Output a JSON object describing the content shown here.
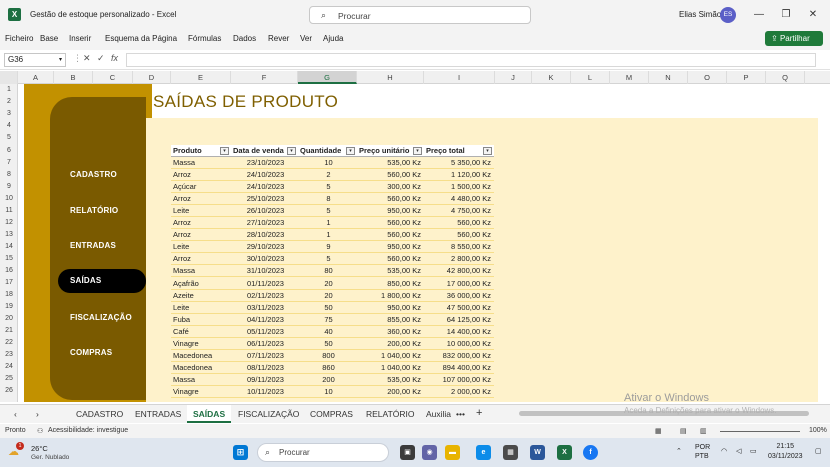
{
  "window": {
    "app_icon": "X",
    "title": "Gestão de estoque personalizado  -  Excel",
    "search_placeholder": "Procurar",
    "user_name": "Elias Simão",
    "user_initials": "ES",
    "btn_minimize": "—",
    "btn_restore": "❐",
    "btn_close": "✕"
  },
  "ribbon": {
    "tabs": [
      "Ficheiro",
      "Base",
      "Inserir",
      "Esquema da Página",
      "Fórmulas",
      "Dados",
      "Rever",
      "Ver",
      "Ajuda"
    ],
    "share_label": "Partilhar"
  },
  "formula_bar": {
    "name_box": "G36",
    "cancel": "✕",
    "enter": "✓",
    "fx": "fx",
    "formula": ""
  },
  "grid": {
    "columns": [
      "A",
      "B",
      "C",
      "D",
      "E",
      "F",
      "G",
      "H",
      "I",
      "J",
      "K",
      "L",
      "M",
      "N",
      "O",
      "P",
      "Q"
    ],
    "selected_column": "G",
    "rows": [
      "1",
      "2",
      "3",
      "4",
      "5",
      "6",
      "7",
      "8",
      "9",
      "10",
      "11",
      "12",
      "13",
      "14",
      "15",
      "16",
      "17",
      "18",
      "19",
      "20",
      "21",
      "22",
      "23",
      "24",
      "25",
      "26"
    ]
  },
  "nav": {
    "items": [
      "CADASTRO",
      "RELATÓRIO",
      "ENTRADAS",
      "SAÍDAS",
      "FISCALIZAÇÃO",
      "COMPRAS"
    ],
    "active": "SAÍDAS"
  },
  "page_title": "SAÍDAS DE PRODUTO",
  "table": {
    "headers": [
      "Produto",
      "Data de venda",
      "Quantidade",
      "Preço unitário",
      "Preço total"
    ],
    "filter_glyph": "▾",
    "rows": [
      [
        "Massa",
        "23/10/2023",
        "10",
        "535,00 Kz",
        "5 350,00 Kz"
      ],
      [
        "Arroz",
        "24/10/2023",
        "2",
        "560,00 Kz",
        "1 120,00 Kz"
      ],
      [
        "Açúcar",
        "24/10/2023",
        "5",
        "300,00 Kz",
        "1 500,00 Kz"
      ],
      [
        "Arroz",
        "25/10/2023",
        "8",
        "560,00 Kz",
        "4 480,00 Kz"
      ],
      [
        "Leite",
        "26/10/2023",
        "5",
        "950,00 Kz",
        "4 750,00 Kz"
      ],
      [
        "Arroz",
        "27/10/2023",
        "1",
        "560,00 Kz",
        "560,00 Kz"
      ],
      [
        "Arroz",
        "28/10/2023",
        "1",
        "560,00 Kz",
        "560,00 Kz"
      ],
      [
        "Leite",
        "29/10/2023",
        "9",
        "950,00 Kz",
        "8 550,00 Kz"
      ],
      [
        "Arroz",
        "30/10/2023",
        "5",
        "560,00 Kz",
        "2 800,00 Kz"
      ],
      [
        "Massa",
        "31/10/2023",
        "80",
        "535,00 Kz",
        "42 800,00 Kz"
      ],
      [
        "Açafrão",
        "01/11/2023",
        "20",
        "850,00 Kz",
        "17 000,00 Kz"
      ],
      [
        "Azeite",
        "02/11/2023",
        "20",
        "1 800,00 Kz",
        "36 000,00 Kz"
      ],
      [
        "Leite",
        "03/11/2023",
        "50",
        "950,00 Kz",
        "47 500,00 Kz"
      ],
      [
        "Fuba",
        "04/11/2023",
        "75",
        "855,00 Kz",
        "64 125,00 Kz"
      ],
      [
        "Café",
        "05/11/2023",
        "40",
        "360,00 Kz",
        "14 400,00 Kz"
      ],
      [
        "Vinagre",
        "06/11/2023",
        "50",
        "200,00 Kz",
        "10 000,00 Kz"
      ],
      [
        "Macedonea",
        "07/11/2023",
        "800",
        "1 040,00 Kz",
        "832 000,00 Kz"
      ],
      [
        "Macedonea",
        "08/11/2023",
        "860",
        "1 040,00 Kz",
        "894 400,00 Kz"
      ],
      [
        "Massa",
        "09/11/2023",
        "200",
        "535,00 Kz",
        "107 000,00 Kz"
      ],
      [
        "Vinagre",
        "10/11/2023",
        "10",
        "200,00 Kz",
        "2 000,00 Kz"
      ]
    ]
  },
  "sheet_tabs": {
    "prev": "‹",
    "next": "›",
    "items": [
      "CADASTRO",
      "ENTRADAS",
      "SAÍDAS",
      "FISCALIZAÇÃO",
      "COMPRAS",
      "RELATÓRIO",
      "Auxilia"
    ],
    "active": "SAÍDAS",
    "more": "•••",
    "add": "+"
  },
  "watermark": {
    "line1": "Ativar o Windows",
    "line2": "Aceda a Definições para ativar o Windows."
  },
  "status": {
    "ready": "Pronto",
    "accessibility": "Acessibilidade: investigue",
    "zoom": "100%"
  },
  "taskbar": {
    "weather_badge": "1",
    "temperature": "26°C",
    "weather_desc": "Ger. Nublado",
    "search_placeholder": "Procurar",
    "language": "POR",
    "keyboard": "PTB",
    "time": "21:15",
    "date": "03/11/2023"
  },
  "colors": {
    "excel_green": "#1d6f42",
    "gold": "#c29100",
    "panel_brown": "#7a5a00",
    "cream": "#fef2cb",
    "title_text": "#7f5f00"
  }
}
